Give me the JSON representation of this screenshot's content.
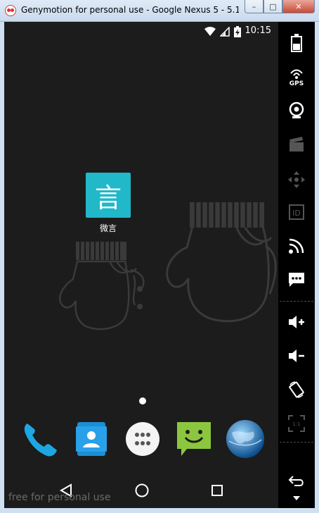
{
  "window": {
    "title": "Genymotion for personal use - Google Nexus 5 - 5.1...",
    "buttons": {
      "minimize": "–",
      "maximize": "□",
      "close": "✕"
    }
  },
  "status_bar": {
    "time": "10:15"
  },
  "home": {
    "shortcut": {
      "glyph": "言",
      "label": "微言",
      "color": "#21b8c9"
    },
    "dock": [
      "phone-icon",
      "contacts-icon",
      "app-drawer-icon",
      "messenger-icon",
      "browser-globe-icon"
    ]
  },
  "watermark": "free for personal use",
  "toolbar": {
    "gps_label": "GPS",
    "id_label": "ID",
    "pixel_label": "1:1"
  }
}
